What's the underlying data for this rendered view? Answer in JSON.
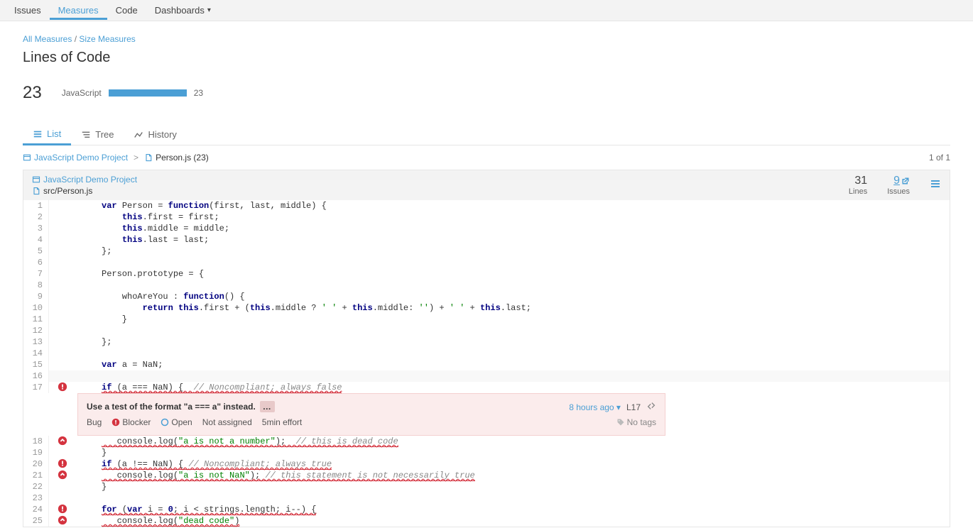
{
  "nav": {
    "issues": "Issues",
    "measures": "Measures",
    "code": "Code",
    "dashboards": "Dashboards"
  },
  "breadcrumb": {
    "all": "All Measures",
    "sep": " / ",
    "size": "Size Measures"
  },
  "title": "Lines of Code",
  "loc": {
    "total": "23",
    "language": "JavaScript",
    "lang_count": "23"
  },
  "view_tabs": {
    "list": "List",
    "tree": "Tree",
    "history": "History"
  },
  "file_crumb": {
    "project": "JavaScript Demo Project",
    "file": "Person.js (23)",
    "position": "1 of 1"
  },
  "viewer": {
    "project": "JavaScript Demo Project",
    "path": "src/Person.js",
    "stats": {
      "lines_n": "31",
      "lines_l": "Lines",
      "issues_n": "9",
      "issues_l": "Issues"
    }
  },
  "issue": {
    "message": "Use a test of the format \"a === a\" instead.",
    "type": "Bug",
    "severity": "Blocker",
    "status": "Open",
    "assignee": "Not assigned",
    "effort": "5min effort",
    "age": "8 hours ago",
    "line": "L17",
    "notags": "No tags"
  },
  "code_lines": [
    {
      "n": "1",
      "tokens": [
        {
          "t": "var ",
          "c": "kw"
        },
        {
          "t": "Person = "
        },
        {
          "t": "function",
          "c": "kw"
        },
        {
          "t": "(first, last, middle) {"
        }
      ]
    },
    {
      "n": "2",
      "tokens": [
        {
          "t": "    "
        },
        {
          "t": "this",
          "c": "kw"
        },
        {
          "t": ".first = first;"
        }
      ]
    },
    {
      "n": "3",
      "tokens": [
        {
          "t": "    "
        },
        {
          "t": "this",
          "c": "kw"
        },
        {
          "t": ".middle = middle;"
        }
      ]
    },
    {
      "n": "4",
      "tokens": [
        {
          "t": "    "
        },
        {
          "t": "this",
          "c": "kw"
        },
        {
          "t": ".last = last;"
        }
      ]
    },
    {
      "n": "5",
      "tokens": [
        {
          "t": "};"
        }
      ]
    },
    {
      "n": "6",
      "tokens": [
        {
          "t": ""
        }
      ]
    },
    {
      "n": "7",
      "tokens": [
        {
          "t": "Person.prototype = {"
        }
      ]
    },
    {
      "n": "8",
      "tokens": [
        {
          "t": ""
        }
      ]
    },
    {
      "n": "9",
      "tokens": [
        {
          "t": "    whoAreYou : "
        },
        {
          "t": "function",
          "c": "kw"
        },
        {
          "t": "() {"
        }
      ]
    },
    {
      "n": "10",
      "tokens": [
        {
          "t": "        "
        },
        {
          "t": "return ",
          "c": "kw"
        },
        {
          "t": "this",
          "c": "kw"
        },
        {
          "t": ".first + ("
        },
        {
          "t": "this",
          "c": "kw"
        },
        {
          "t": ".middle ? "
        },
        {
          "t": "' '",
          "c": "str"
        },
        {
          "t": " + "
        },
        {
          "t": "this",
          "c": "kw"
        },
        {
          "t": ".middle: "
        },
        {
          "t": "''",
          "c": "str"
        },
        {
          "t": ") + "
        },
        {
          "t": "' '",
          "c": "str"
        },
        {
          "t": " + "
        },
        {
          "t": "this",
          "c": "kw"
        },
        {
          "t": ".last;"
        }
      ]
    },
    {
      "n": "11",
      "tokens": [
        {
          "t": "    }"
        }
      ]
    },
    {
      "n": "12",
      "tokens": [
        {
          "t": ""
        }
      ]
    },
    {
      "n": "13",
      "tokens": [
        {
          "t": "};"
        }
      ]
    },
    {
      "n": "14",
      "tokens": [
        {
          "t": ""
        }
      ]
    },
    {
      "n": "15",
      "tokens": [
        {
          "t": "var ",
          "c": "kw"
        },
        {
          "t": "a = NaN;"
        }
      ]
    },
    {
      "n": "16",
      "tokens": [
        {
          "t": ""
        }
      ],
      "hl": true
    },
    {
      "n": "17",
      "tokens": [
        {
          "t": "if ",
          "c": "kw",
          "u": true
        },
        {
          "t": "(a === NaN) {  ",
          "u": true
        },
        {
          "t": "// Noncompliant; always false",
          "c": "cm",
          "u": true
        }
      ],
      "icon": "blocker",
      "issue_after": true
    },
    {
      "n": "18",
      "tokens": [
        {
          "t": "   console.log(",
          "u": true
        },
        {
          "t": "\"a is not a number\"",
          "c": "str",
          "u": true
        },
        {
          "t": ");  ",
          "u": true
        },
        {
          "t": "// this is dead code",
          "c": "cm",
          "u": true
        }
      ],
      "icon": "up"
    },
    {
      "n": "19",
      "tokens": [
        {
          "t": "}"
        }
      ]
    },
    {
      "n": "20",
      "tokens": [
        {
          "t": "if ",
          "c": "kw",
          "u": true
        },
        {
          "t": "(a !== NaN) { ",
          "u": true
        },
        {
          "t": "// Noncompliant; always true",
          "c": "cm",
          "u": true
        }
      ],
      "icon": "blocker"
    },
    {
      "n": "21",
      "tokens": [
        {
          "t": "   console.log(",
          "u": true
        },
        {
          "t": "\"a is not NaN\"",
          "c": "str",
          "u": true
        },
        {
          "t": "); ",
          "u": true
        },
        {
          "t": "// this statement is not necessarily true",
          "c": "cm",
          "u": true
        }
      ],
      "icon": "up"
    },
    {
      "n": "22",
      "tokens": [
        {
          "t": "}"
        }
      ]
    },
    {
      "n": "23",
      "tokens": [
        {
          "t": ""
        }
      ]
    },
    {
      "n": "24",
      "tokens": [
        {
          "t": "for ",
          "c": "kw",
          "u": true
        },
        {
          "t": "(",
          "u": true
        },
        {
          "t": "var ",
          "c": "kw",
          "u": true
        },
        {
          "t": "i = ",
          "u": true
        },
        {
          "t": "0",
          "c": "kw",
          "u": true
        },
        {
          "t": "; i < strings.length; i--) {",
          "u": true
        }
      ],
      "icon": "blocker"
    },
    {
      "n": "25",
      "tokens": [
        {
          "t": "   console.log(",
          "u": true
        },
        {
          "t": "\"dead code\"",
          "c": "str",
          "u": true
        },
        {
          "t": ")",
          "u": true
        }
      ],
      "icon": "up"
    }
  ]
}
